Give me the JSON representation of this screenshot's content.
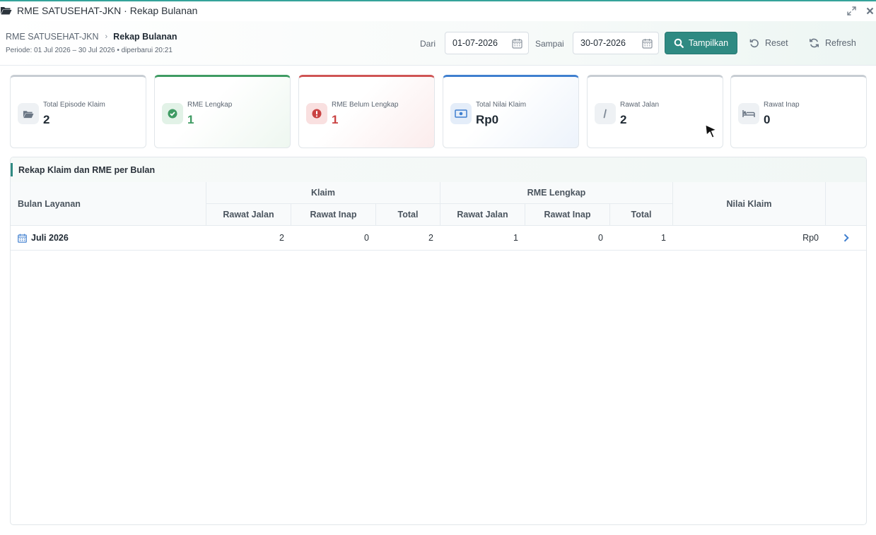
{
  "window": {
    "title": "RME SATUSEHAT-JKN · Rekap Bulanan"
  },
  "header": {
    "breadcrumb_root": "RME SATUSEHAT-JKN",
    "breadcrumb_current": "Rekap Bulanan",
    "periode": "Periode: 01 Jul 2026 – 30 Jul 2026 • diperbarui 20:21"
  },
  "filter": {
    "dari_label": "Dari",
    "dari_value": "01-07-2026",
    "sampai_label": "Sampai",
    "sampai_value": "30-07-2026",
    "tampilkan_label": "Tampilkan",
    "reset_label": "Reset",
    "refresh_label": "Refresh"
  },
  "stats": [
    {
      "label": "Total Episode Klaim",
      "value": "2",
      "icon": "folder-open-icon",
      "accent": "#c7cdd3"
    },
    {
      "label": "RME Lengkap",
      "value": "1",
      "icon": "check-circle-icon",
      "accent": "#3f9b63"
    },
    {
      "label": "RME Belum Lengkap",
      "value": "1",
      "icon": "exclamation-circle-icon",
      "accent": "#cf5454"
    },
    {
      "label": "Total Nilai Klaim",
      "value": "Rp0",
      "icon": "money-bill-icon",
      "accent": "#3f7fcf"
    },
    {
      "label": "Rawat Jalan",
      "value": "2",
      "icon": "walking-icon",
      "accent": "#c7cdd3"
    },
    {
      "label": "Rawat Inap",
      "value": "0",
      "icon": "bed-icon",
      "accent": "#c7cdd3"
    }
  ],
  "table": {
    "title": "Rekap Klaim dan RME per Bulan",
    "headers": {
      "bulan": "Bulan Layanan",
      "klaim_group": "Klaim",
      "rme_group": "RME Lengkap",
      "nilai": "Nilai Klaim",
      "rawat_jalan": "Rawat Jalan",
      "rawat_inap": "Rawat Inap",
      "total": "Total"
    },
    "rows": [
      {
        "bulan": "Juli 2026",
        "klaim_rawat_jalan": "2",
        "klaim_rawat_inap": "0",
        "klaim_total": "2",
        "rme_rawat_jalan": "1",
        "rme_rawat_inap": "0",
        "rme_total": "1",
        "nilai_klaim": "Rp0"
      }
    ]
  }
}
